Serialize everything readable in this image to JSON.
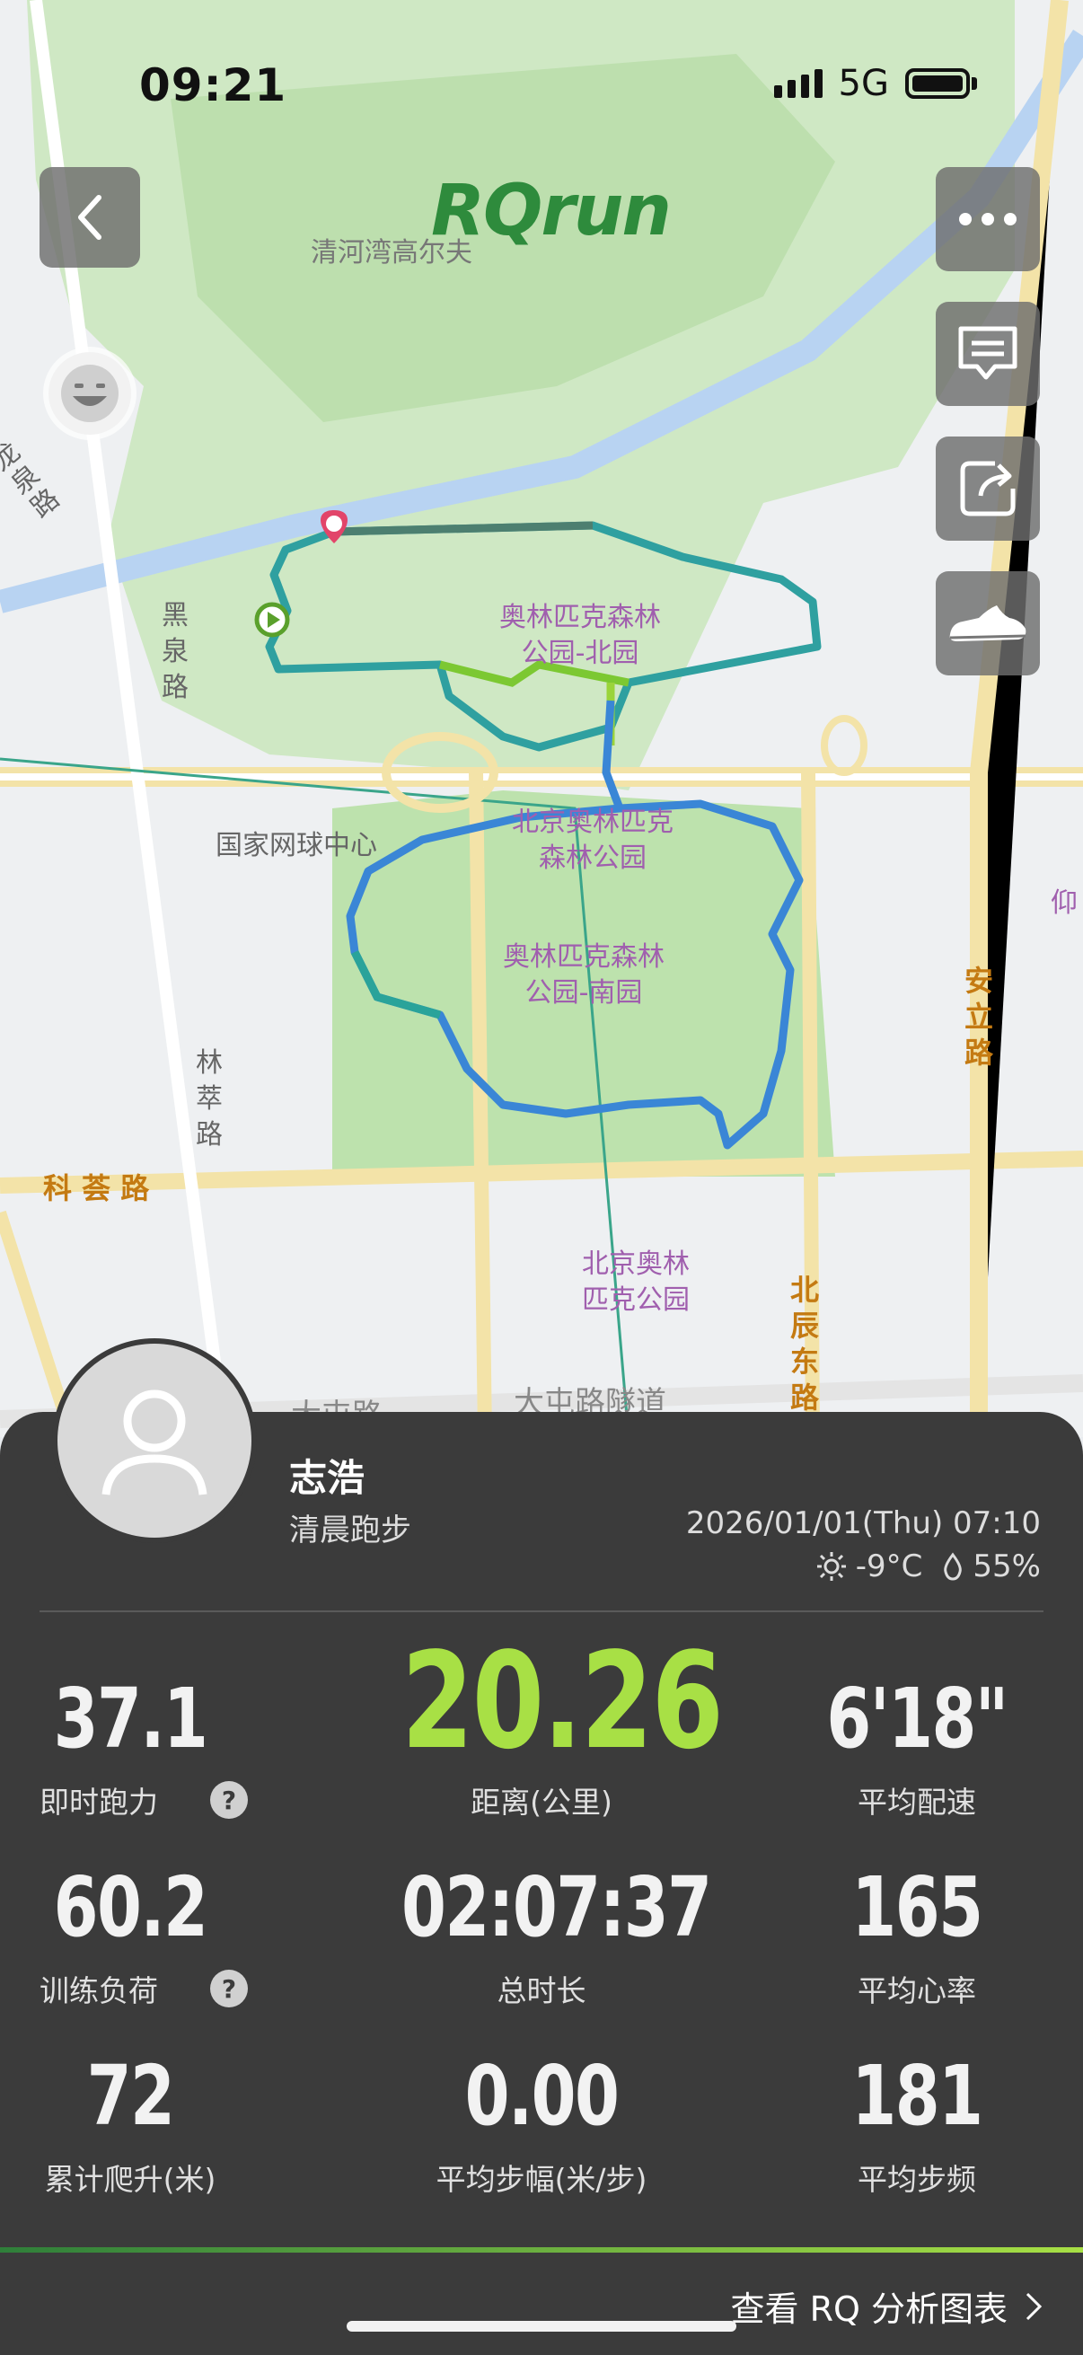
{
  "status_bar": {
    "time": "09:21",
    "network": "5G"
  },
  "map": {
    "logo": "RQrun",
    "labels": {
      "qinghewan": "清河湾高尔夫",
      "north_park": "奥林匹克森林\n公园-北园",
      "olympic_forest": "北京奥林匹克\n森林公园",
      "south_park": "奥林匹克森林\n公园-南园",
      "olympic_park": "北京奥林\n匹克公园",
      "tennis": "国家网球中心"
    },
    "roads": {
      "heiquan": "黑\n泉\n路",
      "lincui": "林\n萃\n路",
      "kehui": "科 荟 路",
      "anli": "安\n立\n路",
      "beichendong": "北\n辰\n东\n路",
      "datun": "大屯路隧道",
      "datun2": "大屯路",
      "yang": "仰",
      "longquan": "龙\n泉\n路"
    }
  },
  "user": {
    "name": "志浩",
    "activity": "清晨跑步",
    "datetime": "2026/01/01(Thu) 07:10",
    "temperature": "-9°C",
    "humidity": "55%"
  },
  "stats": {
    "instant_power": {
      "value": "37.1",
      "label": "即时跑力"
    },
    "distance": {
      "value": "20.26",
      "label": "距离(公里)"
    },
    "avg_pace": {
      "value": "6'18\"",
      "label": "平均配速"
    },
    "training_load": {
      "value": "60.2",
      "label": "训练负荷"
    },
    "total_time": {
      "value": "02:07:37",
      "label": "总时长"
    },
    "avg_hr": {
      "value": "165",
      "label": "平均心率"
    },
    "elevation": {
      "value": "72",
      "label": "累计爬升(米)"
    },
    "avg_stride": {
      "value": "0.00",
      "label": "平均步幅(米/步)"
    },
    "avg_cadence": {
      "value": "181",
      "label": "平均步频"
    }
  },
  "qmark": "?",
  "analysis_link": "查看 RQ 分析图表",
  "colors": {
    "accent": "#a8e045",
    "panel": "#3b3b3b",
    "route_blue": "#3a86d6",
    "route_green": "#7cc832"
  }
}
